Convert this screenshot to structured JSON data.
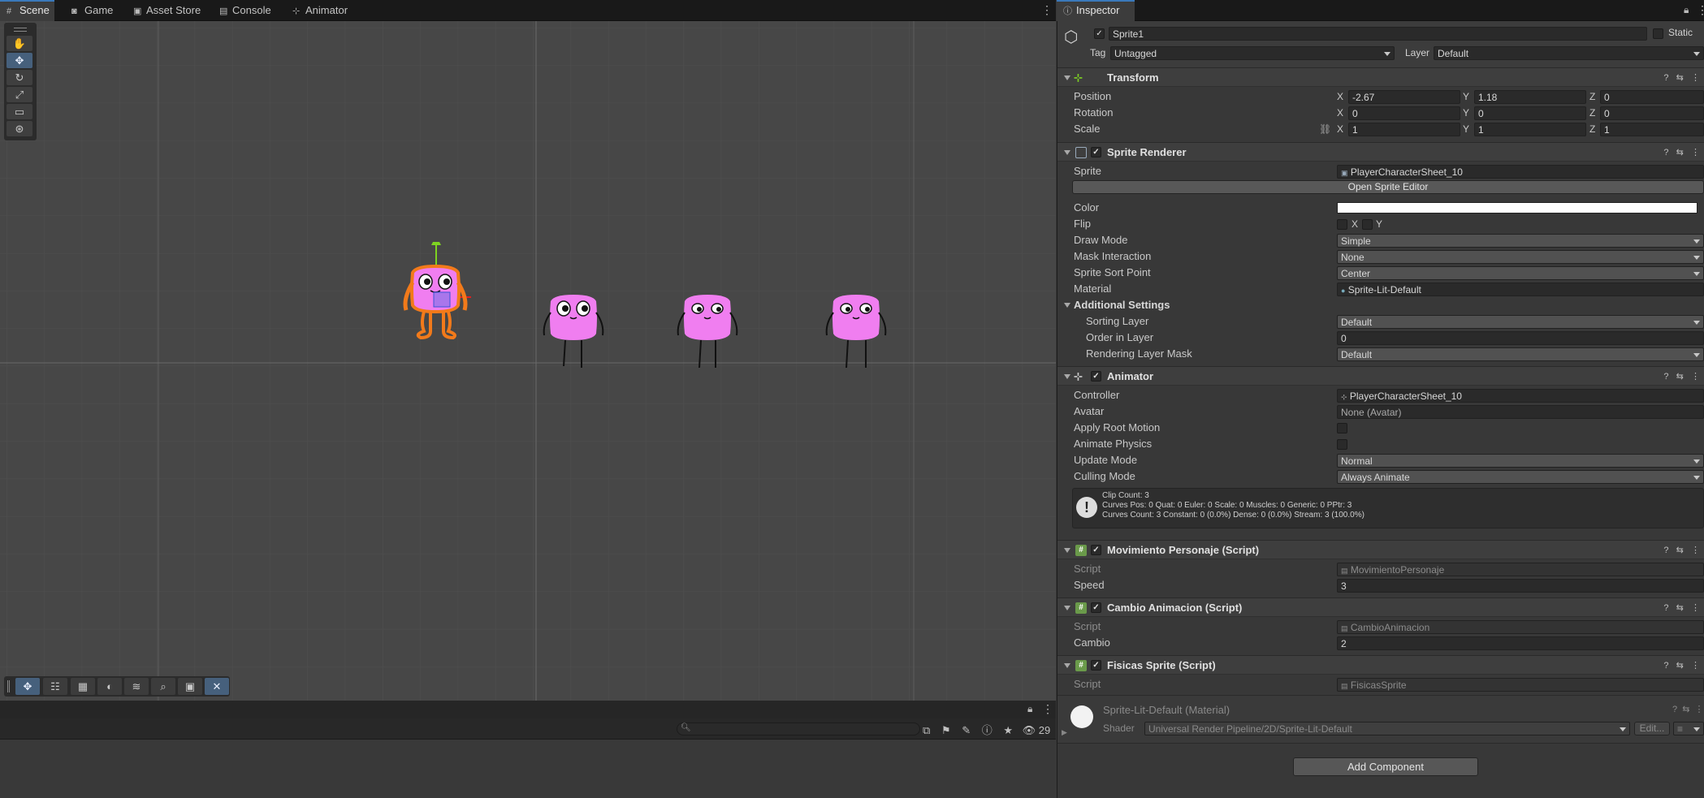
{
  "tabs": [
    "Scene",
    "Game",
    "Asset Store",
    "Console",
    "Animator"
  ],
  "tab_icons": [
    "grid-icon",
    "gamepad-icon",
    "bag-icon",
    "console-icon",
    "animator-icon"
  ],
  "inspector_tab": "Inspector",
  "console_count": "29",
  "object": {
    "name": "Sprite1",
    "static_label": "Static",
    "tag_label": "Tag",
    "tag_value": "Untagged",
    "layer_label": "Layer",
    "layer_value": "Default"
  },
  "transform": {
    "title": "Transform",
    "position_label": "Position",
    "rotation_label": "Rotation",
    "scale_label": "Scale",
    "x": "X",
    "y": "Y",
    "z": "Z",
    "position": [
      "-2.67",
      "1.18",
      "0"
    ],
    "rotation": [
      "0",
      "0",
      "0"
    ],
    "scale": [
      "1",
      "1",
      "1"
    ]
  },
  "sprite_renderer": {
    "title": "Sprite Renderer",
    "sprite_label": "Sprite",
    "sprite_value": "PlayerCharacterSheet_10",
    "open_editor": "Open Sprite Editor",
    "color_label": "Color",
    "flip_label": "Flip",
    "flip_x": "X",
    "flip_y": "Y",
    "draw_mode_label": "Draw Mode",
    "draw_mode": "Simple",
    "mask_label": "Mask Interaction",
    "mask": "None",
    "sort_point_label": "Sprite Sort Point",
    "sort_point": "Center",
    "material_label": "Material",
    "material": "Sprite-Lit-Default",
    "additional": "Additional Settings",
    "sorting_layer_label": "Sorting Layer",
    "sorting_layer": "Default",
    "order_label": "Order in Layer",
    "order": "0",
    "rlm_label": "Rendering Layer Mask",
    "rlm": "Default"
  },
  "animator": {
    "title": "Animator",
    "controller_label": "Controller",
    "controller": "PlayerCharacterSheet_10",
    "avatar_label": "Avatar",
    "avatar": "None (Avatar)",
    "root_motion_label": "Apply Root Motion",
    "physics_label": "Animate Physics",
    "update_label": "Update Mode",
    "update": "Normal",
    "culling_label": "Culling Mode",
    "culling": "Always Animate",
    "info": [
      "Clip Count: 3",
      "Curves Pos: 0 Quat: 0 Euler: 0 Scale: 0 Muscles: 0 Generic: 0 PPtr: 3",
      "Curves Count: 3 Constant: 0 (0.0%) Dense: 0 (0.0%) Stream: 3 (100.0%)"
    ]
  },
  "movimiento": {
    "title": "Movimiento Personaje (Script)",
    "script_label": "Script",
    "script": "MovimientoPersonaje",
    "speed_label": "Speed",
    "speed": "3"
  },
  "cambio": {
    "title": "Cambio Animacion (Script)",
    "script_label": "Script",
    "script": "CambioAnimacion",
    "cambio_label": "Cambio",
    "cambio": "2"
  },
  "fisicas": {
    "title": "Fisicas Sprite (Script)",
    "script_label": "Script",
    "script": "FisicasSprite"
  },
  "material": {
    "title": "Sprite-Lit-Default (Material)",
    "shader_label": "Shader",
    "shader": "Universal Render Pipeline/2D/Sprite-Lit-Default",
    "edit": "Edit..."
  },
  "add_component": "Add Component",
  "colors": {
    "accent": "#3a79bb",
    "character": "#f07ef0",
    "selection": "#f27a1a"
  }
}
